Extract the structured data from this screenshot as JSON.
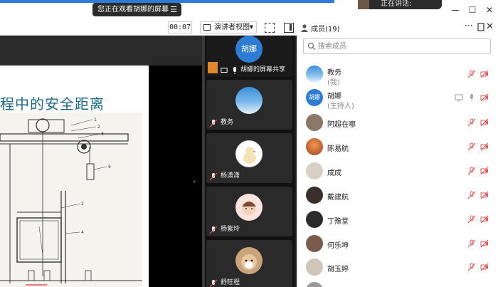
{
  "window": {
    "banner_text": "您正在观看胡娜的屏幕",
    "speaking_text": "正在讲话:"
  },
  "toolbar": {
    "timer": "00:07",
    "view_mode": "演讲者视图"
  },
  "slide": {
    "title_text": "程中的安全距离"
  },
  "video_tiles": [
    {
      "name": "胡娜",
      "label": "胡娜的屏幕共享",
      "avatar_text": "胡娜"
    },
    {
      "name": "教务",
      "label": "教务"
    },
    {
      "name": "杨潇潇",
      "label": "杨潇潇"
    },
    {
      "name": "杨紫玲",
      "label": "杨紫玲"
    },
    {
      "name": "舒旺程",
      "label": "舒旺程"
    }
  ],
  "members_panel": {
    "title": "成员(19)",
    "search_placeholder": "搜索成员",
    "members": [
      {
        "name": "教务",
        "role": "(我)"
      },
      {
        "name": "胡娜",
        "role": "(主持人)",
        "avatar_text": "胡娜"
      },
      {
        "name": "阿超在哪"
      },
      {
        "name": "陈易航"
      },
      {
        "name": "成成"
      },
      {
        "name": "戴建航"
      },
      {
        "name": "丁豫堂"
      },
      {
        "name": "何乐坤"
      },
      {
        "name": "胡玉婷"
      }
    ]
  },
  "colors": {
    "accent_blue": "#2f7bd6",
    "muted_red": "#e05a5a",
    "slide_title": "#1a6a8a"
  }
}
